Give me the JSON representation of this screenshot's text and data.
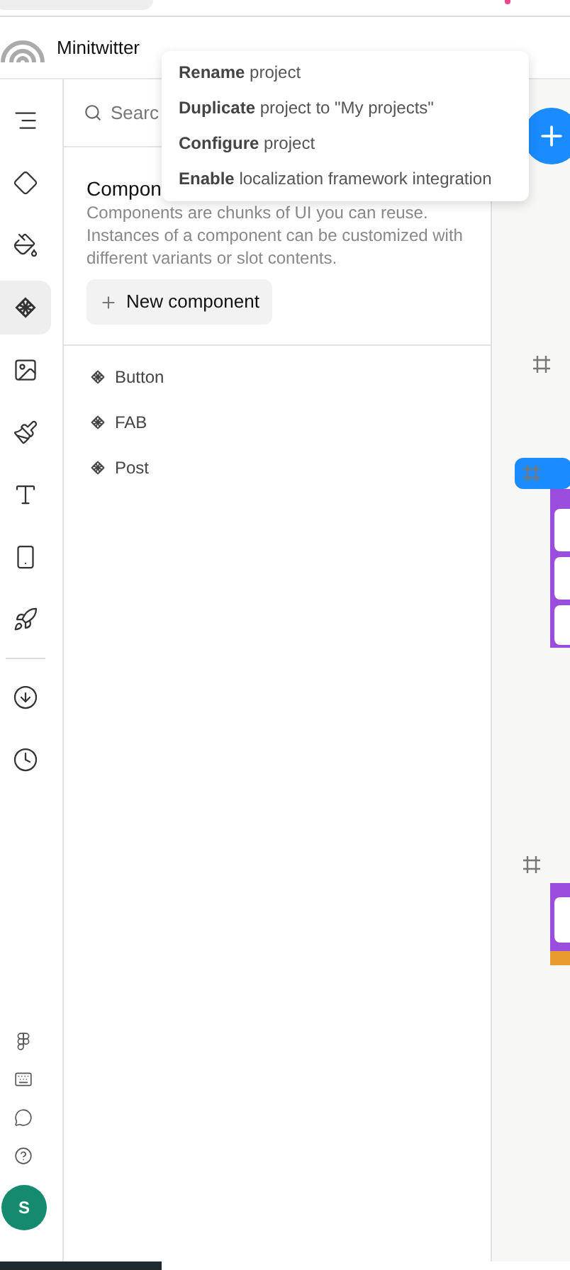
{
  "project": {
    "name": "Minitwitter"
  },
  "rail": {
    "top": [
      {
        "selected": false
      },
      {
        "selected": false
      },
      {
        "selected": false
      },
      {
        "selected": true
      },
      {
        "selected": false
      },
      {
        "selected": false
      },
      {
        "selected": false
      },
      {
        "selected": false
      },
      {
        "selected": false
      }
    ],
    "middle": [
      {
        "selected": false
      },
      {
        "selected": false
      }
    ],
    "avatar": "S"
  },
  "panel": {
    "search": {
      "placeholder": "Searc"
    },
    "heading": "Compon",
    "description": "Components are chunks of UI you can reuse. Instances of a component can be customized with different variants or slot contents.",
    "new_button": "New component",
    "components": [
      {
        "name": "Button"
      },
      {
        "name": "FAB"
      },
      {
        "name": "Post"
      }
    ]
  },
  "menu": [
    {
      "verb": "Rename",
      "rest": " project"
    },
    {
      "verb": "Duplicate",
      "rest": " project to \"My projects\""
    },
    {
      "verb": "Configure",
      "rest": " project"
    },
    {
      "verb": "Enable",
      "rest": " localization framework integration"
    }
  ]
}
